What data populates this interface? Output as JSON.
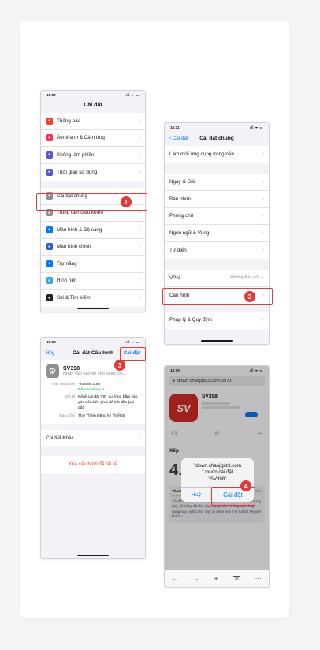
{
  "steps": [
    "1",
    "2",
    "3",
    "4"
  ],
  "screen1": {
    "time": "16:07",
    "status_icons": "ıll ᯤ ▭",
    "title": "Cài đặt",
    "items": [
      {
        "label": "Thông báo",
        "color": "#ff3b30",
        "icon": "bell-icon"
      },
      {
        "label": "Âm thanh & Cảm ứng",
        "color": "#ff2d55",
        "icon": "speaker-icon"
      },
      {
        "label": "Không làm phiền",
        "color": "#5856d6",
        "icon": "moon-icon"
      },
      {
        "label": "Thời gian sử dụng",
        "color": "#5856d6",
        "icon": "hourglass-icon"
      },
      {
        "label": "Cài đặt chung",
        "color": "#8e8e93",
        "icon": "gear-icon"
      },
      {
        "label": "Trung tâm điều khiển",
        "color": "#8e8e93",
        "icon": "toggle-icon"
      },
      {
        "label": "Màn hình & Độ sáng",
        "color": "#007aff",
        "icon": "brightness-icon"
      },
      {
        "label": "Màn hình chính",
        "color": "#2c5ecf",
        "icon": "grid-icon"
      },
      {
        "label": "Trợ năng",
        "color": "#007aff",
        "icon": "accessibility-icon"
      },
      {
        "label": "Hình nền",
        "color": "#34aadc",
        "icon": "flower-icon"
      },
      {
        "label": "Siri & Tìm kiếm",
        "color": "#222222",
        "icon": "siri-icon"
      }
    ]
  },
  "screen2": {
    "time": "16:11",
    "status_icons": "ıll ᯤ ▭",
    "back": "Cài đặt",
    "title": "Cài đặt chung",
    "top_item": "Làm mới ứng dụng trong nền",
    "group1": [
      "Ngày & Giờ",
      "Bàn phím",
      "Phông chữ",
      "Ngôn ngữ & Vùng",
      "Từ điển"
    ],
    "vpn_label": "VPN",
    "vpn_value": "Không Kết nối",
    "profile_label": "Cấu hình",
    "legal_label": "Pháp lý & Quy định"
  },
  "screen3": {
    "time": "16:09",
    "status_icons": "ıll ᯤ ▭",
    "cancel": "Hủy",
    "title": "Cài đặt Cấu hình",
    "install": "Cài đặt",
    "profile_name": "SV398",
    "profile_sub": "Nhấn vào đây để cho phép cài...",
    "signed_by_key": "Xác nhận bởi",
    "signed_by_val": "*.ios88s.com",
    "verified": "Đã xác minh ✓",
    "desc_key": "Mô tả",
    "desc_val": "Kênh cài đặt VIP, vui lòng bấm vào góc trên bên phải để bắt đầu [cài đặt]",
    "contains_key": "Bao gồm",
    "contains_val": "Thư Thêm Đăng ký Thiết bị",
    "more_details": "Chi tiết Khác",
    "remove": "Xóa cấu hình đã tải về"
  },
  "screen4": {
    "time": "16:10",
    "status_icons": "ıll ᯤ ▭",
    "url": "down.chaojqxz3.com:3972",
    "app_name": "SV398",
    "app_logo": "SV",
    "rating_value": "4.9",
    "rating_count": "#1",
    "age": "4+",
    "big_rating": "4.9",
    "section_title": "Xếp",
    "review_title": "Thích nó rất nhiều",
    "review_meta": "Thứ năm",
    "review_stars": "★★★★★",
    "review_text": "Tôi đã thấy tất cả đồng nghiệp của mình chơi ứng dụng này, tôi cũng đã thử ứng dụng này. Không ngờ ứng dụng này lại tốt như vậy và Hình ảnh tỉ lệ hai tốt khuyến khích ! !",
    "dialog_line1": "\"down.chaojqxz3.com",
    "dialog_line2": "\" muốn cài đặt",
    "dialog_line3": "\"SV398\"",
    "dialog_cancel": "Huỷ",
    "dialog_install": "Cài đặt",
    "tab_count": "30"
  }
}
